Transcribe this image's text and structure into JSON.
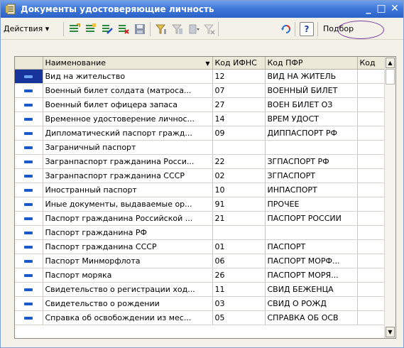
{
  "window": {
    "title": "Документы удостоверяющие личность",
    "minimize_glyph": "_",
    "maximize_glyph": "□",
    "close_glyph": "✕"
  },
  "toolbar": {
    "actions_label": "Действия ▾",
    "icons": [
      "add-icon",
      "add-copy-icon",
      "edit-icon",
      "delete-mark-icon",
      "save-icon",
      "filter-icon",
      "filter-clear-icon",
      "filter-list-icon",
      "filter-off-icon",
      "refresh-icon"
    ],
    "help_label": "?",
    "podbor_label": "Подбор"
  },
  "grid": {
    "columns": [
      "",
      "Наименование",
      "Код ИФНС",
      "Код ПФР",
      "Код"
    ],
    "rows": [
      {
        "name": "Вид на жительство",
        "ifns": "12",
        "pfr": "ВИД НА ЖИТЕЛЬ",
        "code": ""
      },
      {
        "name": "Военный билет солдата (матроса...",
        "ifns": "07",
        "pfr": "ВОЕННЫЙ БИЛЕТ",
        "code": ""
      },
      {
        "name": "Военный билет офицера запаса",
        "ifns": "27",
        "pfr": "ВОЕН БИЛЕТ ОЗ",
        "code": ""
      },
      {
        "name": "Временное удостоверение личнос...",
        "ifns": "14",
        "pfr": "ВРЕМ УДОСТ",
        "code": ""
      },
      {
        "name": "Дипломатический паспорт гражд...",
        "ifns": "09",
        "pfr": "ДИППАСПОРТ РФ",
        "code": ""
      },
      {
        "name": "Заграничный паспорт",
        "ifns": "",
        "pfr": "",
        "code": ""
      },
      {
        "name": "Загранпаспорт гражданина Росси...",
        "ifns": "22",
        "pfr": "ЗГПАСПОРТ РФ",
        "code": ""
      },
      {
        "name": "Загранпаспорт гражданина СССР",
        "ifns": "02",
        "pfr": "ЗГПАСПОРТ",
        "code": ""
      },
      {
        "name": "Иностранный паспорт",
        "ifns": "10",
        "pfr": "ИНПАСПОРТ",
        "code": ""
      },
      {
        "name": "Иные документы, выдаваемые ор...",
        "ifns": "91",
        "pfr": "ПРОЧЕЕ",
        "code": ""
      },
      {
        "name": "Паспорт гражданина Российской ...",
        "ifns": "21",
        "pfr": "ПАСПОРТ РОССИИ",
        "code": ""
      },
      {
        "name": "Паспорт гражданина РФ",
        "ifns": "",
        "pfr": "",
        "code": ""
      },
      {
        "name": "Паспорт гражданина СССР",
        "ifns": "01",
        "pfr": "ПАСПОРТ",
        "code": ""
      },
      {
        "name": "Паспорт Минморфлота",
        "ifns": "06",
        "pfr": "ПАСПОРТ МОРФ...",
        "code": ""
      },
      {
        "name": "Паспорт моряка",
        "ifns": "26",
        "pfr": "ПАСПОРТ МОРЯ...",
        "code": ""
      },
      {
        "name": "Свидетельство о регистрации ход...",
        "ifns": "11",
        "pfr": "СВИД БЕЖЕНЦА",
        "code": ""
      },
      {
        "name": "Свидетельство о рождении",
        "ifns": "03",
        "pfr": "СВИД О РОЖД",
        "code": ""
      },
      {
        "name": "Справка об освобождении из мес...",
        "ifns": "05",
        "pfr": "СПРАВКА ОБ ОСВ",
        "code": ""
      }
    ]
  },
  "colors": {
    "title_gradient_top": "#6f9fea",
    "title_gradient_bottom": "#2a62c8",
    "selected_marker": "#16349c",
    "row_icon": "#1d5ac9",
    "podbor_highlight": "#7a3aa8"
  }
}
